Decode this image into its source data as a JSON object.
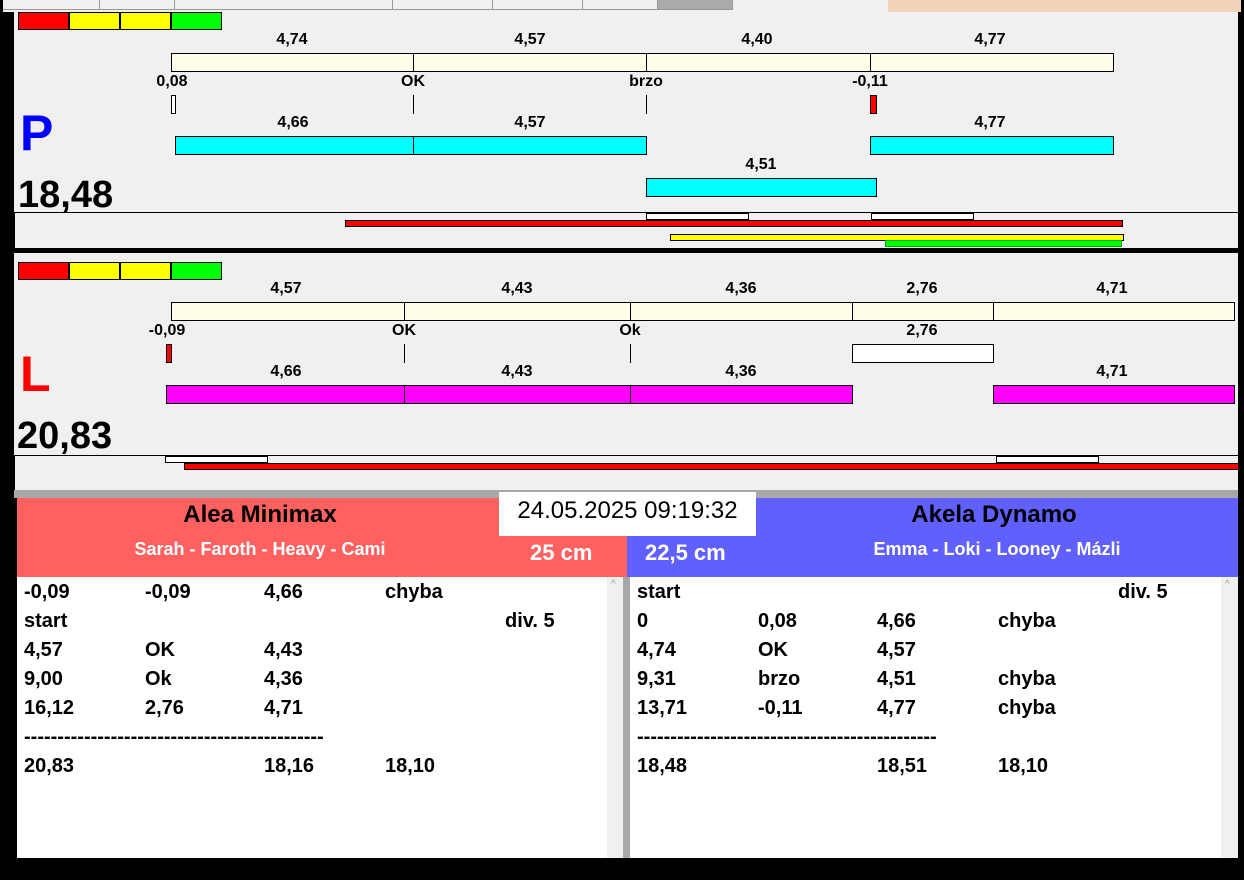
{
  "lanes": [
    {
      "letter": "P",
      "total": "18,48",
      "row1": [
        "4,74",
        "4,57",
        "4,40",
        "4,77"
      ],
      "row2": [
        "0,08",
        "OK",
        "brzo",
        "-0,11"
      ],
      "row3": [
        "4,66",
        "4,57",
        "4,77"
      ],
      "row4": [
        "4,51"
      ]
    },
    {
      "letter": "L",
      "total": "20,83",
      "row1": [
        "4,57",
        "4,43",
        "4,36",
        "2,76",
        "4,71"
      ],
      "row2": [
        "-0,09",
        "OK",
        "Ok",
        "2,76"
      ],
      "row3": [
        "4,66",
        "4,43",
        "4,36",
        "4,71"
      ]
    }
  ],
  "datetime": "24.05.2025 09:19:32",
  "left_team": {
    "name": "Alea Minimax",
    "dogs": "Sarah - Faroth - Heavy - Cami",
    "height": "25 cm"
  },
  "right_team": {
    "name": "Akela Dynamo",
    "dogs": "Emma - Loki - Looney - Mázli",
    "height": "22,5 cm"
  },
  "left_list": [
    [
      "-0,09",
      "-0,09",
      "4,66",
      "chyba",
      ""
    ],
    [
      "start",
      "",
      "",
      "",
      "div.  5"
    ],
    [
      "4,57",
      "OK",
      "4,43",
      "",
      ""
    ],
    [
      "9,00",
      "Ok",
      "4,36",
      "",
      ""
    ],
    [
      "16,12",
      "2,76",
      "4,71",
      "",
      ""
    ],
    [
      "---------------------------------------------",
      "",
      "",
      "",
      ""
    ],
    [
      "20,83",
      "",
      "18,16",
      "18,10",
      ""
    ]
  ],
  "right_list": [
    [
      "start",
      "",
      "",
      "",
      "div.  5"
    ],
    [
      "0",
      "0,08",
      "4,66",
      "chyba",
      ""
    ],
    [
      "4,74",
      "OK",
      "4,57",
      "",
      ""
    ],
    [
      "9,31",
      "brzo",
      "4,51",
      "chyba",
      ""
    ],
    [
      "13,71",
      "-0,11",
      "4,77",
      "chyba",
      ""
    ],
    [
      "---------------------------------------------",
      "",
      "",
      "",
      ""
    ],
    [
      "18,48",
      "",
      "18,51",
      "18,10",
      ""
    ]
  ],
  "colors": {
    "left": "#ff6060",
    "right": "#6060ff",
    "cyan": "#00ffff",
    "magenta": "#ff00ff",
    "bar": "#fffde8"
  }
}
